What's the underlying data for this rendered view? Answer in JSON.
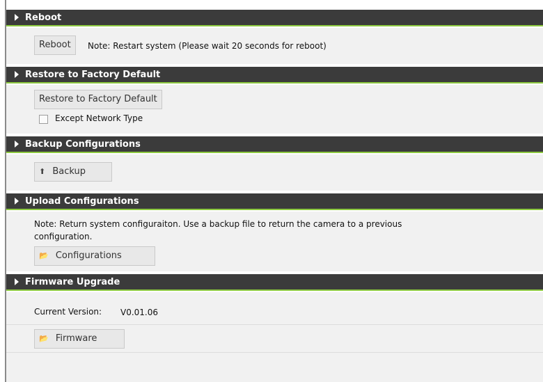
{
  "sections": {
    "reboot": {
      "title": "Reboot",
      "button_label": "Reboot",
      "note": "Note: Restart system (Please wait 20 seconds for reboot)"
    },
    "restore": {
      "title": "Restore to Factory Default",
      "button_label": "Restore to Factory Default",
      "checkbox_label": "Except Network Type",
      "checkbox_checked": false
    },
    "backup": {
      "title": "Backup Configurations",
      "button_label": "Backup"
    },
    "upload": {
      "title": "Upload Configurations",
      "note_line1": "Note: Return system configuraiton. Use a backup file to return the camera to a previous",
      "note_line2": "configuration.",
      "button_label": "Configurations"
    },
    "firmware": {
      "title": "Firmware Upgrade",
      "current_version_label": "Current Version:",
      "current_version_value": "V0.01.06",
      "button_label": "Firmware"
    }
  },
  "icons": {
    "header_toggle": "triangle-right-icon",
    "backup_button": "up-arrow-icon",
    "configurations_button": "folder-open-icon",
    "firmware_button": "folder-open-icon"
  },
  "colors": {
    "header_bg": "#3b3b3b",
    "header_accent": "#8cc83f",
    "body_bg": "#f1f1f1",
    "button_bg": "#e8e8e8"
  }
}
